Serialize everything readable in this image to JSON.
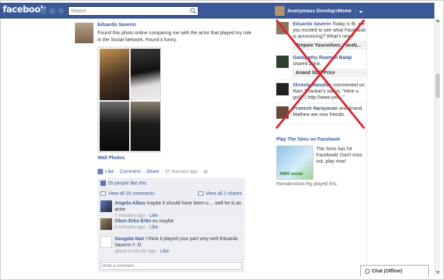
{
  "header": {
    "logo": "facebook",
    "search_placeholder": "Search",
    "user_name": "Anonymous Developer",
    "home_label": "Home"
  },
  "post": {
    "author": "Eduardo Saverin",
    "text": "Found this photo online comparing me with the actor that played my role in the Social Network. Found it funny.",
    "photo_caption": "Wall Photos",
    "action_like": "Like",
    "action_comment": "Comment",
    "action_share": "Share",
    "time": "37 minutes ago",
    "likes_text": "55 people like this.",
    "view_comments": "View all 25 comments",
    "view_shares": "View all 2 shares",
    "comments": [
      {
        "author": "Angela Albus",
        "text": "maybe it should have been u.... well he is an actor",
        "time": "7 minutes ago",
        "like": "Like"
      },
      {
        "author": "Oben Erko Erko",
        "text": "eu maybe",
        "time": "6 minutes ago",
        "like": "Like"
      },
      {
        "author": "Sougata Nair",
        "text": "I think it played your part very well Eduardo Saverin !! :D",
        "time": "about a minute ago",
        "like": "Like"
      }
    ],
    "write_placeholder": "Write a comment..."
  },
  "ticker": [
    {
      "name": "Eduardo Saverin",
      "text": "Today is f8, are you excited to see what Facebook is announcing? What's new?",
      "sub": "Prepare Yourselves: Faceb..."
    },
    {
      "name": "Ganapathy Raaman Balaji",
      "text": "shared a link.",
      "sub": "Anand Stall Price"
    },
    {
      "name": "Shreela Manohar",
      "text": "commented on Ram Shankar's status: \"Here u go!!! :) http://www.you...\"",
      "sub": ""
    },
    {
      "name": "Pranesh Narayanan",
      "text": "and Anand Mathew are now friends.",
      "sub": ""
    }
  ],
  "ad": {
    "title": "Play The Sims on Facebook",
    "text": "The Sims has hit Facebook! Don't miss out, play now!",
    "footer": "Ramakrishna Rg played this.",
    "img_label": "SIMS social"
  },
  "chat": {
    "label": "Chat (Offline)"
  },
  "colors": {
    "brand": "#3b5998",
    "cross": "#d9232e"
  }
}
